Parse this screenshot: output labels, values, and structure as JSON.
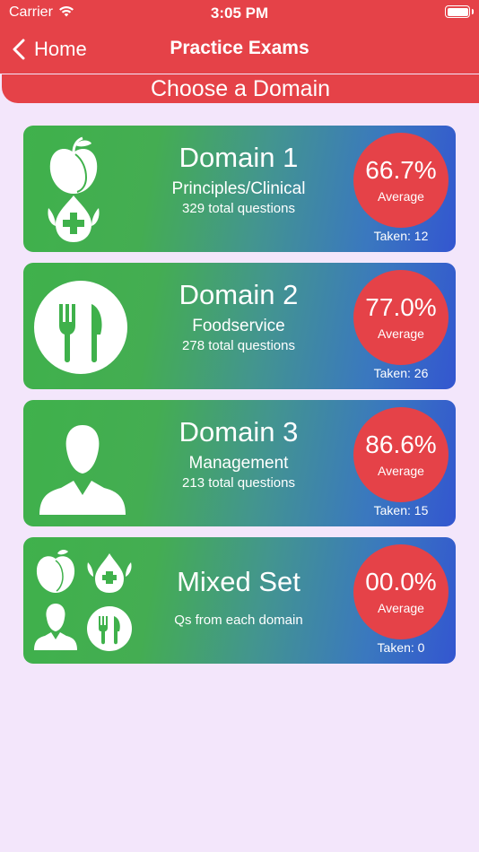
{
  "status": {
    "carrier": "Carrier",
    "time": "3:05 PM"
  },
  "nav": {
    "back_label": "Home",
    "title": "Practice Exams"
  },
  "section_title": "Choose a Domain",
  "cards": [
    {
      "title": "Domain 1",
      "subtitle": "Principles/Clinical",
      "count": "329 total questions",
      "percent": "66.7%",
      "avg_label": "Average",
      "taken": "Taken: 12",
      "icon": "apple-dropper-icon"
    },
    {
      "title": "Domain 2",
      "subtitle": "Foodservice",
      "count": "278 total questions",
      "percent": "77.0%",
      "avg_label": "Average",
      "taken": "Taken: 26",
      "icon": "fork-knife-icon"
    },
    {
      "title": "Domain 3",
      "subtitle": "Management",
      "count": "213 total questions",
      "percent": "86.6%",
      "avg_label": "Average",
      "taken": "Taken: 15",
      "icon": "person-icon"
    },
    {
      "title": "Mixed Set",
      "subtitle": "Qs from each domain",
      "percent": "00.0%",
      "avg_label": "Average",
      "taken": "Taken: 0",
      "icon": "mixed-domains-icon"
    }
  ],
  "colors": {
    "accent": "#e54248",
    "background": "#f3e6fb",
    "gradient_start": "#3fb14b",
    "gradient_end": "#3356d0"
  }
}
